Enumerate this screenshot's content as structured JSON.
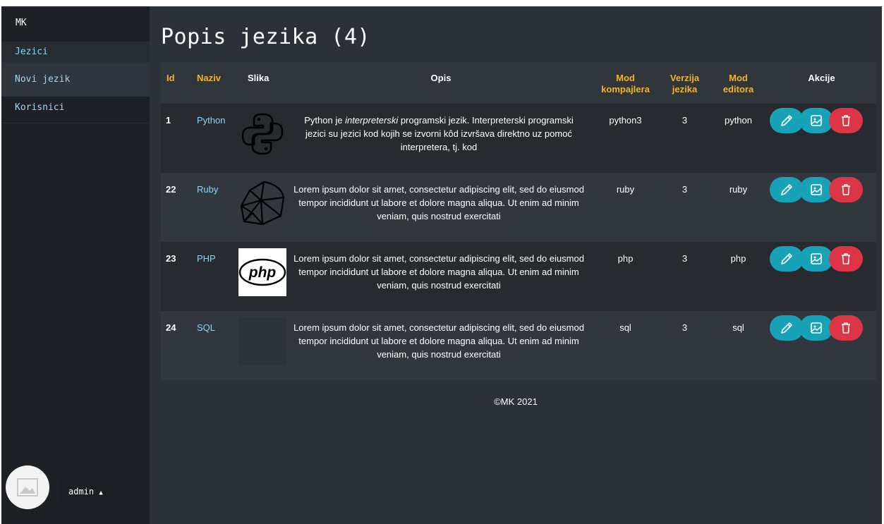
{
  "sidebar": {
    "brand": "MK",
    "items": [
      {
        "label": "Jezici"
      },
      {
        "label": "Novi jezik"
      },
      {
        "label": "Korisnici"
      }
    ],
    "user": "admin"
  },
  "page_title": "Popis jezika (4)",
  "table": {
    "headers": {
      "id": "Id",
      "naziv": "Naziv",
      "slika": "Slika",
      "opis": "Opis",
      "mod_kompajlera_1": "Mod",
      "mod_kompajlera_2": "kompajlera",
      "verzija_1": "Verzija",
      "verzija_2": "jezika",
      "mod_editora_1": "Mod",
      "mod_editora_2": "editora",
      "akcije": "Akcije"
    },
    "rows": [
      {
        "id": "1",
        "naziv": "Python",
        "opis_pre": "Python je ",
        "opis_em": "interpreterski",
        "opis_post": " programski jezik. Interpreterski programski jezici su jezici kod kojih se izvorni kôd izvršava direktno uz pomoć interpretera, tj. kod",
        "mod_kompajlera": "python3",
        "verzija": "3",
        "mod_editora": "python",
        "image_icon": "python-logo"
      },
      {
        "id": "22",
        "naziv": "Ruby",
        "opis": "Lorem ipsum dolor sit amet, consectetur adipiscing elit, sed do eiusmod tempor incididunt ut labore et dolore magna aliqua. Ut enim ad minim veniam, quis nostrud exercitati",
        "mod_kompajlera": "ruby",
        "verzija": "3",
        "mod_editora": "ruby",
        "image_icon": "ruby-gem-logo"
      },
      {
        "id": "23",
        "naziv": "PHP",
        "opis": "Lorem ipsum dolor sit amet, consectetur adipiscing elit, sed do eiusmod tempor incididunt ut labore et dolore magna aliqua. Ut enim ad minim veniam, quis nostrud exercitati",
        "mod_kompajlera": "php",
        "verzija": "3",
        "mod_editora": "php",
        "image_icon": "php-logo",
        "image_logo_text": "php"
      },
      {
        "id": "24",
        "naziv": "SQL",
        "opis": "Lorem ipsum dolor sit amet, consectetur adipiscing elit, sed do eiusmod tempor incididunt ut labore et dolore magna aliqua. Ut enim ad minim veniam, quis nostrud exercitati",
        "mod_kompajlera": "sql",
        "verzija": "3",
        "mod_editora": "sql",
        "image_icon": "empty-image"
      }
    ]
  },
  "footer": "©MK 2021",
  "colors": {
    "accent_gold": "#f0b429",
    "link_blue": "#8fd2f2",
    "info": "#17a2b8",
    "danger": "#dc3545",
    "sidebar_bg": "#1d2024",
    "main_bg": "#2c3137"
  }
}
